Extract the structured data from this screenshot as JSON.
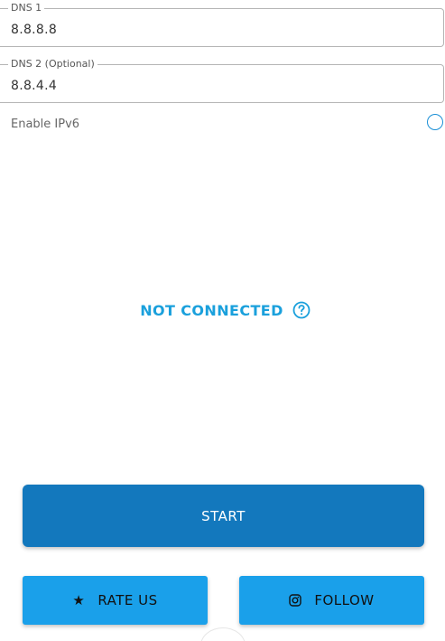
{
  "dns1": {
    "label": "DNS 1",
    "value": "8.8.8.8"
  },
  "dns2": {
    "label": "DNS 2 (Optional)",
    "value": "8.8.4.4"
  },
  "ipv6": {
    "label": "Enable IPv6",
    "checked": false
  },
  "status": {
    "text": "NOT CONNECTED",
    "color": "#1aa0dc",
    "help_icon": "question-circle-icon"
  },
  "actions": {
    "start_label": "START",
    "rate_label": "RATE US",
    "rate_icon": "star-icon",
    "follow_label": "FOLLOW",
    "follow_icon": "instagram-icon"
  },
  "colors": {
    "primary_dark": "#1378bd",
    "primary_light": "#1aa0ea"
  }
}
